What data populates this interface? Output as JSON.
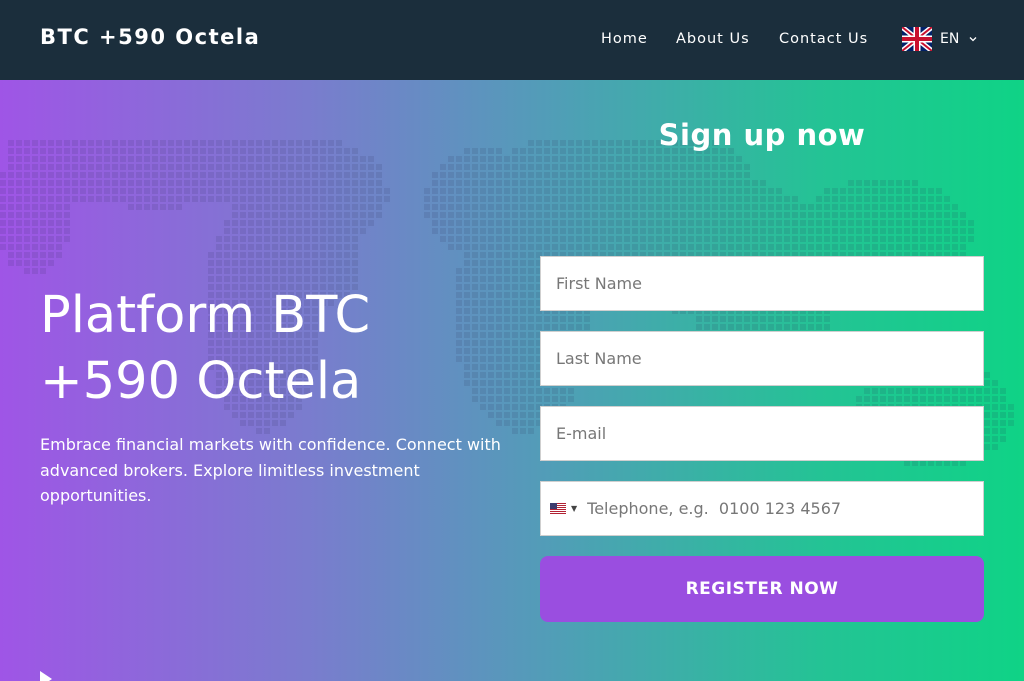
{
  "header": {
    "brand": "BTC +590 Octela",
    "nav": [
      "Home",
      "About Us",
      "Contact Us"
    ],
    "language": {
      "code": "EN",
      "flag": "uk-flag-icon"
    }
  },
  "hero": {
    "headline": "Platform BTC +590 Octela",
    "subtext": "Embrace financial markets with confidence. Connect with advanced brokers. Explore limitless investment opportunities."
  },
  "form": {
    "title": "Sign up now",
    "first_name_placeholder": "First Name",
    "last_name_placeholder": "Last Name",
    "email_placeholder": "E-mail",
    "phone_placeholder": "Telephone, e.g.  0100 123 4567",
    "phone_flag": "us-flag-icon",
    "submit_label": "REGISTER NOW"
  },
  "colors": {
    "header_bg": "#1b2e3c",
    "gradient_start": "#9f55e6",
    "gradient_end": "#0fd386",
    "button": "#9a4ee0"
  }
}
